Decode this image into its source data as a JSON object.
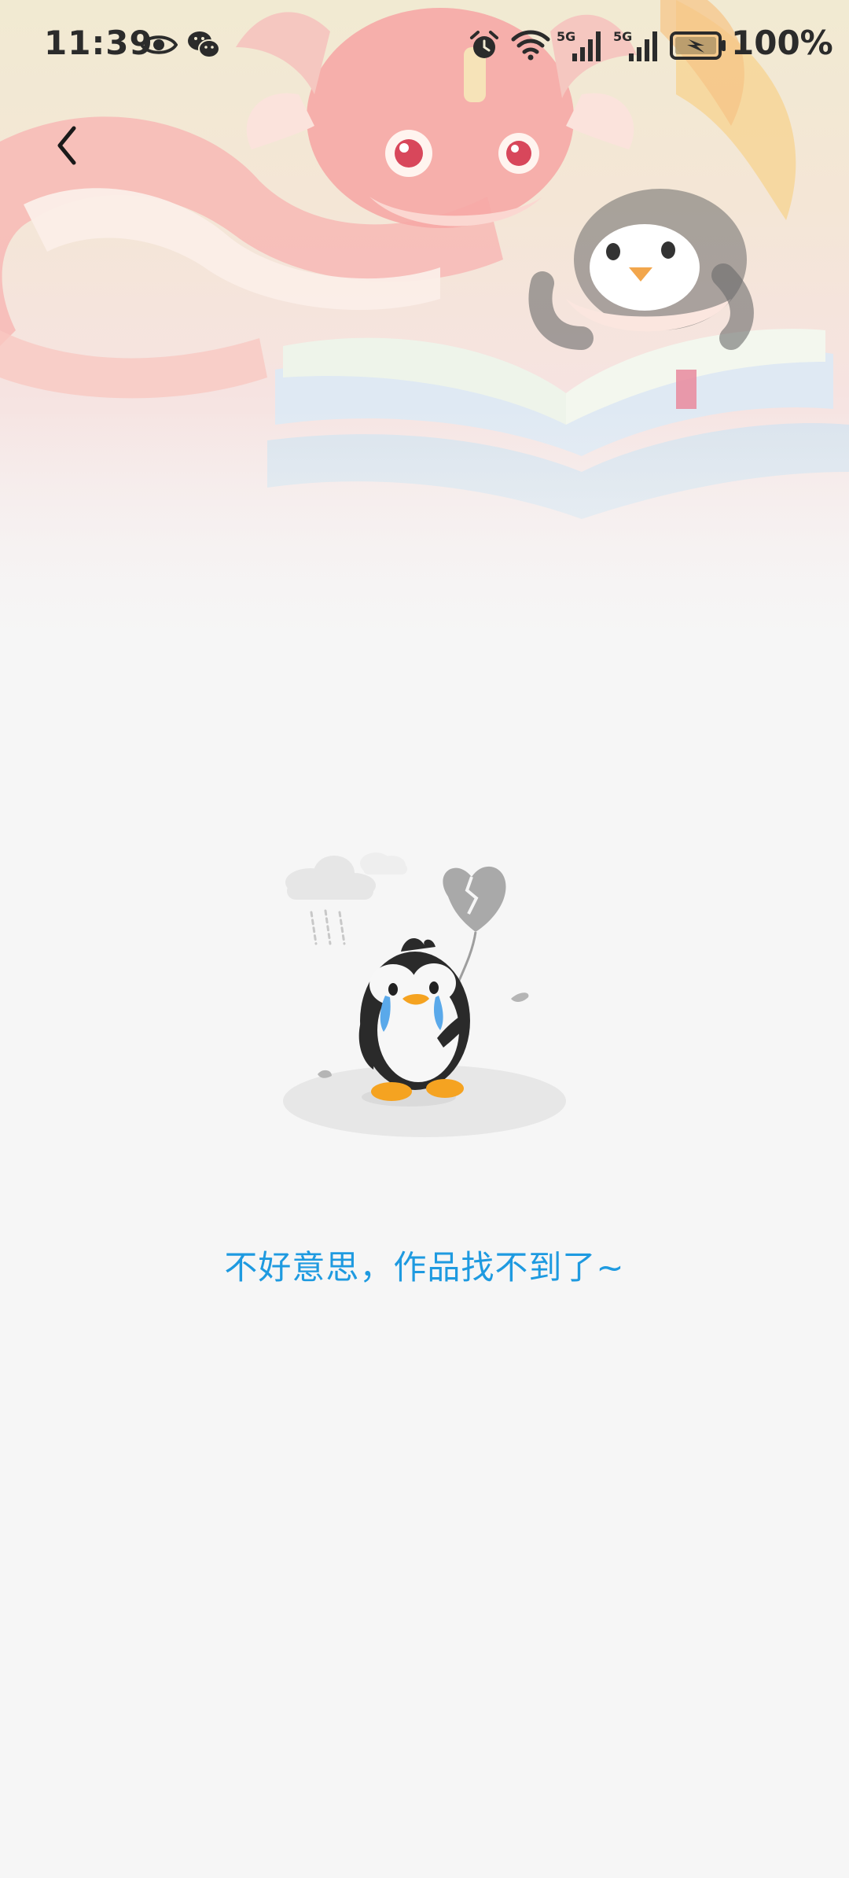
{
  "status_bar": {
    "time": "11:39",
    "battery_percent": "100%",
    "network_labels": [
      "5G",
      "5G"
    ],
    "icons": [
      "eye-icon",
      "wechat-icon",
      "alarm-icon",
      "wifi-icon",
      "signal-icon",
      "signal-icon",
      "battery-charging-icon"
    ]
  },
  "nav": {
    "back_icon": "chevron-left-icon"
  },
  "empty_state": {
    "message": "不好意思，作品找不到了~",
    "illustration": "crying-penguin-broken-heart-balloon"
  },
  "colors": {
    "accent": "#1e9ae0",
    "background": "#f6f6f6",
    "status_text": "#2b2b2b"
  }
}
